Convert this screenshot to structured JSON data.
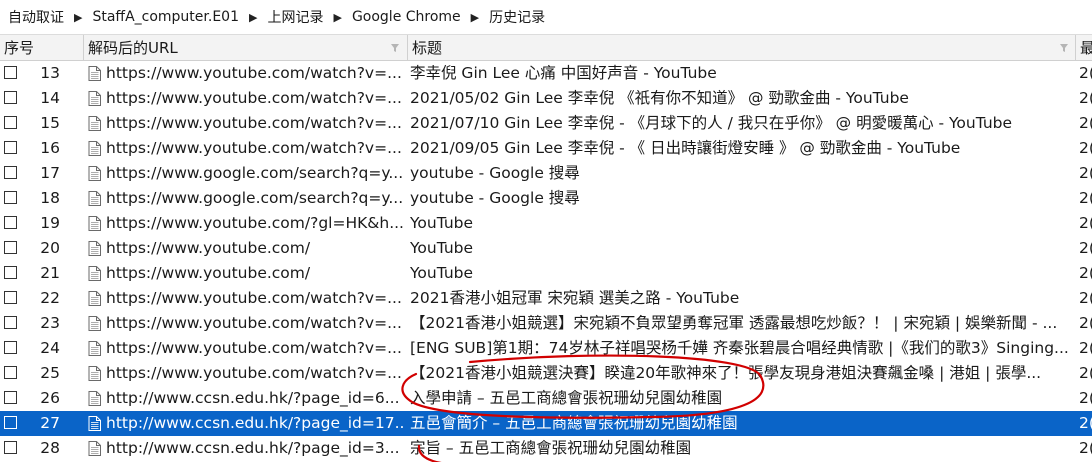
{
  "breadcrumb": [
    "自动取证",
    "StaffA_computer.E01",
    "上网记录",
    "Google Chrome",
    "历史记录"
  ],
  "breadcrumb_separator": "▶",
  "columns": {
    "seq": "序号",
    "url": "解码后的URL",
    "title": "标题",
    "last": "最"
  },
  "selected_row": 27,
  "colors": {
    "selection": "#0a64c8",
    "annotation": "#d10000"
  },
  "rows": [
    {
      "seq": "13",
      "url": "https://www.youtube.com/watch?v=...",
      "title": "李幸倪 Gin Lee 心痛 中国好声音 - YouTube",
      "last": "2("
    },
    {
      "seq": "14",
      "url": "https://www.youtube.com/watch?v=...",
      "title": "2021/05/02 Gin Lee 李幸倪 《祇有你不知道》 @ 勁歌金曲 - YouTube",
      "last": "2("
    },
    {
      "seq": "15",
      "url": "https://www.youtube.com/watch?v=...",
      "title": "2021/07/10 Gin Lee 李幸倪 - 《月球下的人 / 我只在乎你》 @ 明愛暖萬心 - YouTube",
      "last": "2("
    },
    {
      "seq": "16",
      "url": "https://www.youtube.com/watch?v=...",
      "title": "2021/09/05 Gin Lee 李幸倪 - 《 日出時讓街燈安睡 》 @ 勁歌金曲 - YouTube",
      "last": "2("
    },
    {
      "seq": "17",
      "url": "https://www.google.com/search?q=y...",
      "title": "youtube - Google 搜尋",
      "last": "2("
    },
    {
      "seq": "18",
      "url": "https://www.google.com/search?q=y...",
      "title": "youtube - Google 搜尋",
      "last": "2("
    },
    {
      "seq": "19",
      "url": "https://www.youtube.com/?gl=HK&h...",
      "title": "YouTube",
      "last": "2("
    },
    {
      "seq": "20",
      "url": "https://www.youtube.com/",
      "title": "YouTube",
      "last": "2("
    },
    {
      "seq": "21",
      "url": "https://www.youtube.com/",
      "title": "YouTube",
      "last": "2("
    },
    {
      "seq": "22",
      "url": "https://www.youtube.com/watch?v=...",
      "title": "2021香港小姐冠軍 宋宛穎 選美之路 - YouTube",
      "last": "2("
    },
    {
      "seq": "23",
      "url": "https://www.youtube.com/watch?v=...",
      "title": "【2021香港小姐競選】宋宛穎不負眾望勇奪冠軍 透露最想吃炒飯？！ | 宋宛穎 | 娛樂新聞 - ...",
      "last": "2("
    },
    {
      "seq": "24",
      "url": "https://www.youtube.com/watch?v=...",
      "title": "[ENG SUB]第1期：74岁林子祥唱哭杨千嬅 齐秦张碧晨合唱经典情歌 |《我们的歌3》Singing...",
      "last": "2("
    },
    {
      "seq": "25",
      "url": "https://www.youtube.com/watch?v=...",
      "title": "【2021香港小姐競選決賽】睽違20年歌神來了！張學友現身港姐決賽飆金嗓 | 港姐 | 張學...",
      "last": "2("
    },
    {
      "seq": "26",
      "url": "http://www.ccsn.edu.hk/?page_id=6...",
      "title": "入學申請 – 五邑工商總會張祝珊幼兒園幼稚園",
      "last": "2("
    },
    {
      "seq": "27",
      "url": "http://www.ccsn.edu.hk/?page_id=17...",
      "title": "五邑會簡介 – 五邑工商總會張祝珊幼兒園幼稚園",
      "last": "2("
    },
    {
      "seq": "28",
      "url": "http://www.ccsn.edu.hk/?page_id=3...",
      "title": "宗旨 – 五邑工商總會張祝珊幼兒園幼稚園",
      "last": "2("
    }
  ]
}
